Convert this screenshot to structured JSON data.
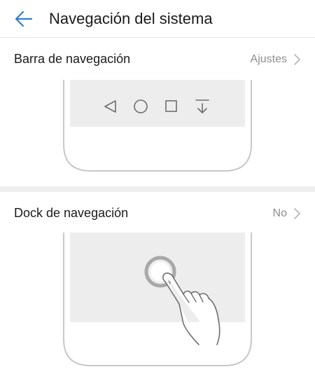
{
  "header": {
    "title": "Navegación del sistema",
    "back_icon": "arrow-left-icon",
    "accent_color": "#2a7fd4"
  },
  "sections": [
    {
      "label": "Barra de navegación",
      "value": "Ajustes",
      "illustration_icons": [
        "back-triangle-icon",
        "home-circle-icon",
        "recent-square-icon",
        "notification-pull-icon"
      ]
    },
    {
      "label": "Dock de navegación",
      "value": "No",
      "illustration_icons": [
        "floating-dock-icon",
        "hand-pointer-icon"
      ]
    }
  ],
  "colors": {
    "text_primary": "#1a1a1a",
    "text_secondary": "#8c8c8c",
    "divider": "#e6e6e6",
    "panel_fill": "#ededed",
    "device_outline": "#c8c8c8"
  }
}
